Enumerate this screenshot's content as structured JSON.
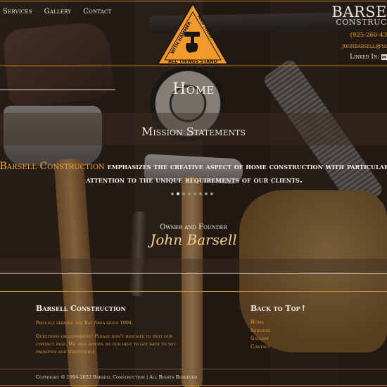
{
  "nav": {
    "items": [
      "Services",
      "Gallery",
      "Contact"
    ]
  },
  "logo": {
    "text_left": "WITH HAMMER",
    "text_right": "AND HAND",
    "tagline": "ALL THINGS STAND"
  },
  "brand": {
    "line1": "BARSE",
    "line2": "CONSTRUC"
  },
  "contact": {
    "phone": "(925-260-43",
    "email": "johnbarsell@ya",
    "linkedin_label": "Linked In:",
    "linkedin_icon": "linkedin-icon"
  },
  "main": {
    "page_title": "Home",
    "section_title": "Mission Statements",
    "statement_brand": "Barsell Construction",
    "statement_line1": "emphasizes the creative aspect of home construction with particular",
    "statement_line2": "attention to the unique requirements of our clients.",
    "carousel": {
      "count": 8,
      "active": 1
    },
    "owner_label": "Owner and Founder",
    "owner_name": "John Barsell"
  },
  "footer": {
    "company_title": "Barsell Construction",
    "serving": "Proudly serving the Bay Area since 1994.",
    "questions_1": "Questions or comments! Please don't hesitate to visit our",
    "questions_2": "contact page. We will always do our best to get back to you",
    "questions_3": "promptly and thoroughly.",
    "back_to_top": "Back to Top",
    "back_to_top_arrow": "↑",
    "links": [
      "Home",
      "Services",
      "Gallery",
      "Contact"
    ],
    "copyright": "Copyright © 1994-2022 Barsell Construction | All Rights Reserved"
  },
  "colors": {
    "accent": "#f0a63a",
    "line": "#c98a2c",
    "text_light": "#f3ede6"
  }
}
